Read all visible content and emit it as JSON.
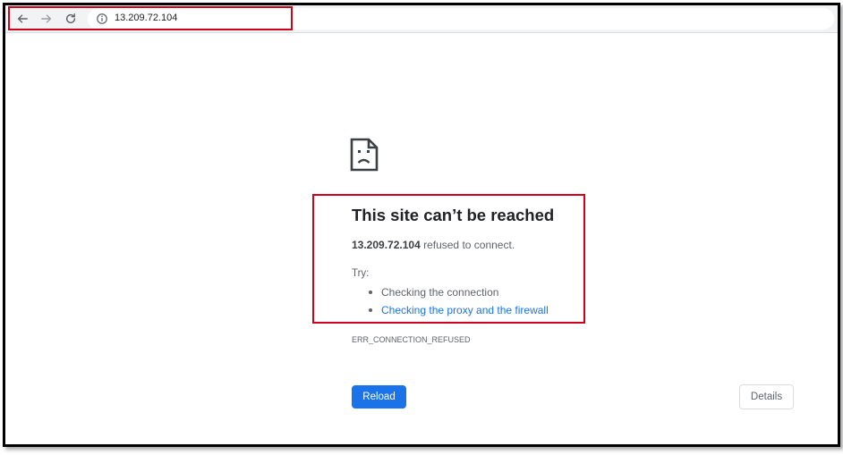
{
  "toolbar": {
    "url": "13.209.72.104",
    "back_icon": "arrow-left-icon",
    "forward_icon": "arrow-right-icon",
    "reload_icon": "reload-icon",
    "site_info_icon": "info-circle-icon"
  },
  "error_page": {
    "icon": "sad-document-icon",
    "heading": "This site can’t be reached",
    "host": "13.209.72.104",
    "message_suffix": " refused to connect.",
    "try_label": "Try:",
    "suggestions": [
      "Checking the connection",
      "Checking the proxy and the firewall"
    ],
    "error_code": "ERR_CONNECTION_REFUSED",
    "reload_label": "Reload",
    "details_label": "Details"
  },
  "colors": {
    "highlight": "#d0021b",
    "link": "#1a73e8",
    "primary_button": "#1a73e8",
    "text": "#202124",
    "secondary_text": "#5f6368"
  }
}
